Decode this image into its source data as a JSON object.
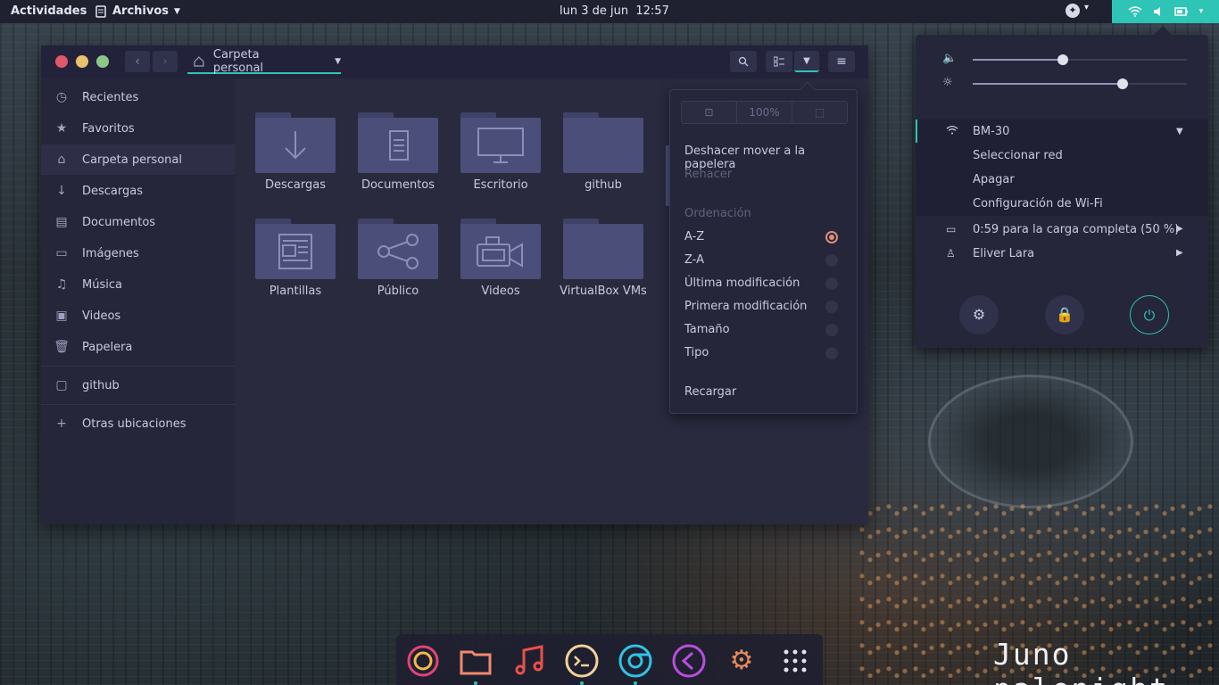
{
  "topbar": {
    "activities": "Actividades",
    "app_menu": "Archivos",
    "clock_date": "lun  3 de jun",
    "clock_time": "12:57"
  },
  "window": {
    "path_label": "Carpeta personal",
    "sidebar": [
      {
        "label": "Recientes",
        "icon": "clock-icon"
      },
      {
        "label": "Favoritos",
        "icon": "star-icon"
      },
      {
        "label": "Carpeta personal",
        "icon": "home-icon"
      },
      {
        "label": "Descargas",
        "icon": "download-icon"
      },
      {
        "label": "Documentos",
        "icon": "document-icon"
      },
      {
        "label": "Imágenes",
        "icon": "image-icon"
      },
      {
        "label": "Música",
        "icon": "music-icon"
      },
      {
        "label": "Videos",
        "icon": "video-icon"
      },
      {
        "label": "Papelera",
        "icon": "trash-icon"
      },
      {
        "label": "github",
        "icon": "folder-icon"
      },
      {
        "label": "Otras ubicaciones",
        "icon": "plus-icon"
      }
    ],
    "folders": [
      {
        "label": "Descargas",
        "icon": "download-icon"
      },
      {
        "label": "Documentos",
        "icon": "document-icon"
      },
      {
        "label": "Escritorio",
        "icon": "monitor-icon"
      },
      {
        "label": "github",
        "icon": "folder-icon"
      },
      {
        "label": "Plantillas",
        "icon": "template-icon"
      },
      {
        "label": "Público",
        "icon": "share-icon"
      },
      {
        "label": "Videos",
        "icon": "camera-icon"
      },
      {
        "label": "VirtualBox VMs",
        "icon": "folder-icon"
      }
    ]
  },
  "popover": {
    "zoom_level": "100%",
    "undo": "Deshacer mover a la papelera",
    "redo": "Rehacer",
    "sort_heading": "Ordenación",
    "sort_options": [
      "A-Z",
      "Z-A",
      "Última modificación",
      "Primera modificación",
      "Tamaño",
      "Tipo"
    ],
    "selected_sort": "A-Z",
    "reload": "Recargar"
  },
  "sysmenu": {
    "volume_level": 0.42,
    "brightness_level": 0.7,
    "wifi_name": "BM-30",
    "wifi_options": [
      "Seleccionar red",
      "Apagar",
      "Configuración de Wi-Fi"
    ],
    "battery": "0:59 para la carga completa (50 %)",
    "user": "Eliver Lara"
  },
  "dock": {
    "apps": [
      "firefox-icon",
      "files-icon",
      "music-icon",
      "terminal-icon",
      "chrome-icon",
      "vscode-icon",
      "settings-icon",
      "app-grid-icon"
    ]
  },
  "watermark": "Juno palenight",
  "colors": {
    "accent": "#2ec4b6",
    "radio_selected": "#e08c7a",
    "window_bg": "#292a3e",
    "sidebar_bg": "#25263a"
  }
}
